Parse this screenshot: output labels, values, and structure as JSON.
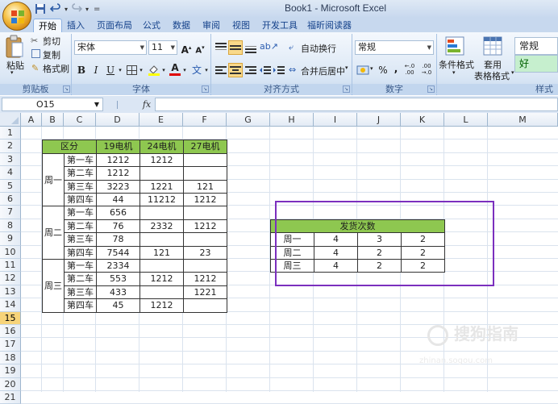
{
  "window": {
    "title": "Book1 - Microsoft Excel"
  },
  "quick_access": {
    "undo_arrow": "▾",
    "redo_arrow": "▾",
    "customize": "="
  },
  "tabs": [
    "开始",
    "插入",
    "页面布局",
    "公式",
    "数据",
    "审阅",
    "视图",
    "开发工具",
    "福昕阅读器"
  ],
  "ribbon": {
    "clipboard": {
      "paste": "粘贴",
      "cut": "剪切",
      "copy": "复制",
      "format_painter": "格式刷",
      "label": "剪贴板"
    },
    "font": {
      "name": "宋体",
      "size": "11",
      "grow": "A",
      "shrink": "A",
      "bold": "B",
      "italic": "I",
      "underline": "U",
      "label": "字体",
      "wen": "文"
    },
    "alignment": {
      "wrap": "自动换行",
      "merge": "合并后居中",
      "label": "对齐方式"
    },
    "number": {
      "format": "常规",
      "percent": "%",
      "comma": ",",
      "inc_dec": ".0 .00",
      "dec_dec": ".00 .0",
      "label": "数字"
    },
    "styles": {
      "conditional": "条件格式",
      "table_line1": "套用",
      "table_line2": "表格格式",
      "style_normal": "常规",
      "style_good": "好",
      "label": "样式"
    }
  },
  "formula_bar": {
    "name_box": "O15",
    "fx": "fx",
    "formula": ""
  },
  "columns": [
    "A",
    "B",
    "C",
    "D",
    "E",
    "F",
    "G",
    "H",
    "I",
    "J",
    "K",
    "L",
    "M"
  ],
  "rows": [
    "1",
    "2",
    "3",
    "4",
    "5",
    "6",
    "7",
    "8",
    "9",
    "10",
    "11",
    "12",
    "13",
    "14",
    "15",
    "16",
    "17",
    "18",
    "19",
    "20",
    "21"
  ],
  "table1": {
    "header": [
      "区分",
      "19电机",
      "24电机",
      "27电机"
    ],
    "groups": [
      {
        "week": "周一",
        "rows": [
          {
            "car": "第一车",
            "v": [
              "1212",
              "1212",
              ""
            ]
          },
          {
            "car": "第二车",
            "v": [
              "1212",
              "",
              ""
            ]
          },
          {
            "car": "第三车",
            "v": [
              "3223",
              "1221",
              "121"
            ]
          },
          {
            "car": "第四车",
            "v": [
              "44",
              "11212",
              "1212"
            ]
          }
        ]
      },
      {
        "week": "周二",
        "rows": [
          {
            "car": "第一车",
            "v": [
              "656",
              "",
              ""
            ]
          },
          {
            "car": "第二车",
            "v": [
              "76",
              "2332",
              "1212"
            ]
          },
          {
            "car": "第三车",
            "v": [
              "78",
              "",
              ""
            ]
          },
          {
            "car": "第四车",
            "v": [
              "7544",
              "121",
              "23"
            ]
          }
        ]
      },
      {
        "week": "周三",
        "rows": [
          {
            "car": "第一车",
            "v": [
              "2334",
              "",
              ""
            ]
          },
          {
            "car": "第二车",
            "v": [
              "553",
              "1212",
              "1212"
            ]
          },
          {
            "car": "第三车",
            "v": [
              "433",
              "",
              "1221"
            ]
          },
          {
            "car": "第四车",
            "v": [
              "45",
              "1212",
              ""
            ]
          }
        ]
      }
    ]
  },
  "table2": {
    "title": "发货次数",
    "rows": [
      {
        "week": "周一",
        "v": [
          "4",
          "3",
          "2"
        ]
      },
      {
        "week": "周二",
        "v": [
          "4",
          "2",
          "2"
        ]
      },
      {
        "week": "周三",
        "v": [
          "4",
          "2",
          "2"
        ]
      }
    ]
  },
  "watermark": {
    "text": "搜狗指南",
    "url": "zhinan.sogou.com"
  },
  "colors": {
    "header_green": "#8ec750",
    "highlight_border": "#7b2fbe",
    "selected_row": "#f7d47a"
  }
}
